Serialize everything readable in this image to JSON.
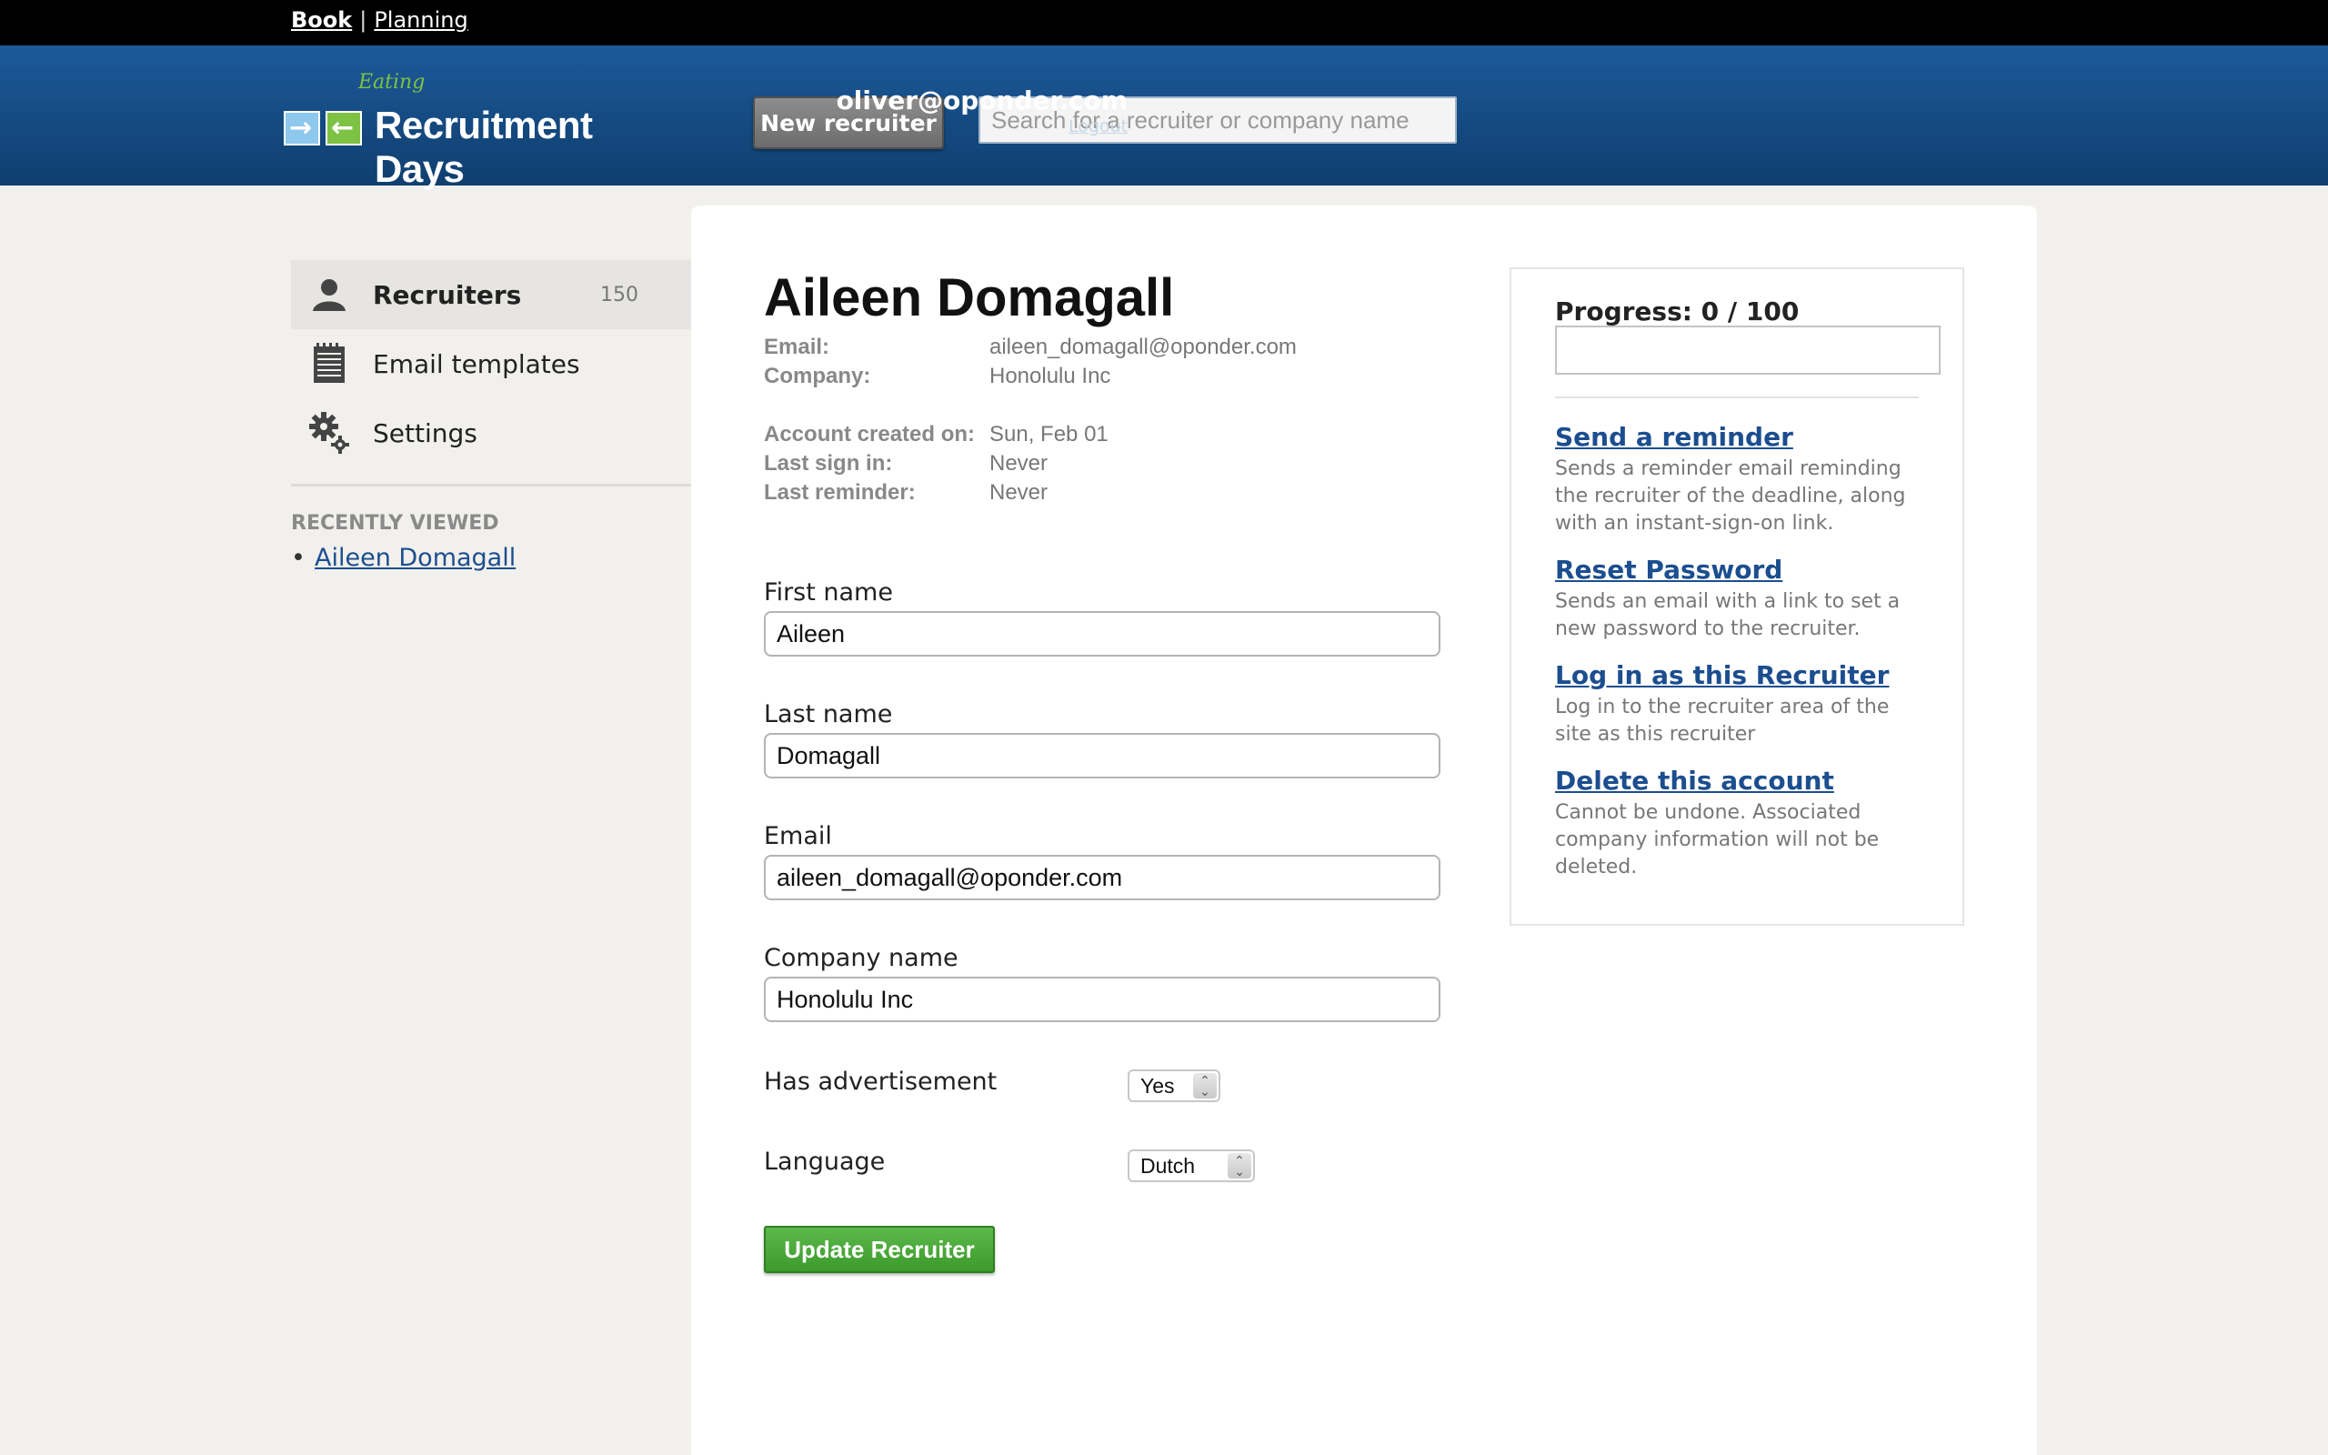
{
  "topnav": {
    "book": "Book",
    "separator": "|",
    "planning": "Planning"
  },
  "header": {
    "logo_script": "Eating",
    "logo_title": "Recruitment Days",
    "new_recruiter": "New recruiter",
    "search_placeholder": "Search for a recruiter or company name",
    "user_email": "oliver@oponder.com",
    "logout": "Logout"
  },
  "sidebar": {
    "items": [
      {
        "label": "Recruiters",
        "count": "150",
        "icon": "person-icon"
      },
      {
        "label": "Email templates",
        "icon": "notepad-icon"
      },
      {
        "label": "Settings",
        "icon": "gears-icon"
      }
    ],
    "recent_title": "RECENTLY VIEWED",
    "recent_items": [
      "Aileen Domagall"
    ]
  },
  "recruiter": {
    "name": "Aileen Domagall",
    "meta": [
      {
        "key": "Email:",
        "value": "aileen_domagall@oponder.com"
      },
      {
        "key": "Company:",
        "value": "Honolulu Inc"
      },
      {
        "key": "Account created on:",
        "value": "Sun, Feb 01"
      },
      {
        "key": "Last sign in:",
        "value": "Never"
      },
      {
        "key": "Last reminder:",
        "value": "Never"
      }
    ]
  },
  "form": {
    "first_name_label": "First name",
    "first_name_value": "Aileen",
    "last_name_label": "Last name",
    "last_name_value": "Domagall",
    "email_label": "Email",
    "email_value": "aileen_domagall@oponder.com",
    "company_label": "Company name",
    "company_value": "Honolulu Inc",
    "advert_label": "Has advertisement",
    "advert_value": "Yes",
    "language_label": "Language",
    "language_value": "Dutch",
    "submit": "Update Recruiter"
  },
  "actions": {
    "progress_label": "Progress: 0 / 100",
    "progress_value": 0,
    "progress_max": 100,
    "items": [
      {
        "title": "Send a reminder",
        "desc": "Sends a reminder email reminding the recruiter of the deadline, along with an instant-sign-on link."
      },
      {
        "title": "Reset Password",
        "desc": "Sends an email with a link to set a new password to the recruiter."
      },
      {
        "title": "Log in as this Recruiter",
        "desc": "Log in to the recruiter area of the site as this recruiter"
      },
      {
        "title": "Delete this account",
        "desc": "Cannot be undone. Associated company information will not be deleted."
      }
    ]
  },
  "colors": {
    "header_blue": "#14497f",
    "link_blue": "#1c4e8f",
    "button_green": "#3c9a2c"
  }
}
